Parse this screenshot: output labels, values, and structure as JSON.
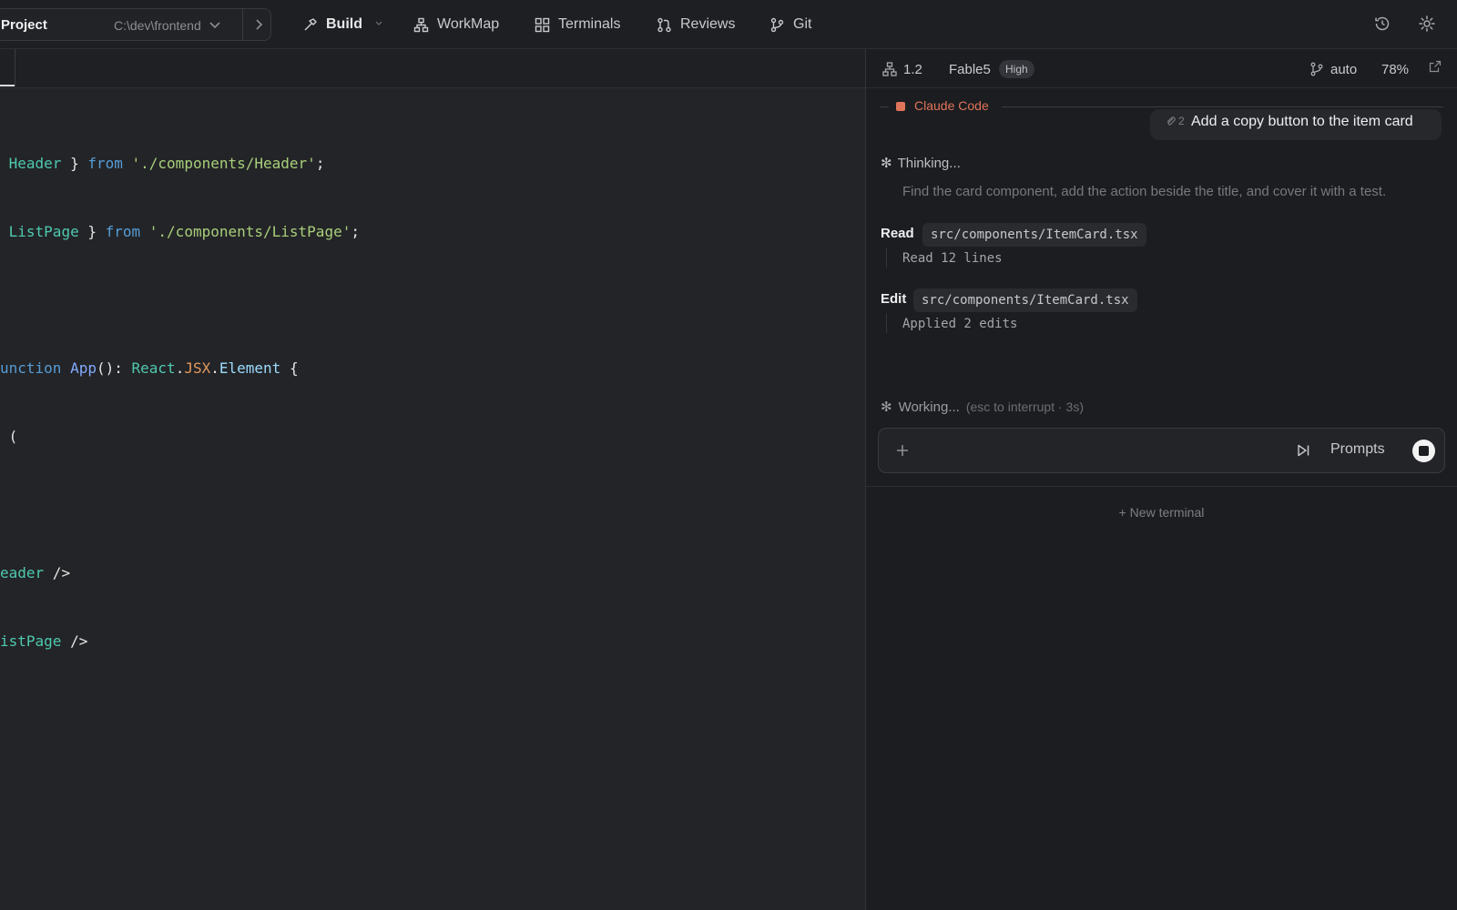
{
  "topbar": {
    "project_label": "Project",
    "project_path": "C:\\dev\\frontend",
    "nav": {
      "build": "Build",
      "workmap": "WorkMap",
      "terminals": "Terminals",
      "reviews": "Reviews",
      "git": "Git"
    },
    "icons": [
      "history-icon",
      "settings-gear-icon"
    ]
  },
  "editor": {
    "lines": [
      {
        "t1": "Header",
        "t2": " } ",
        "t3": "from",
        "t4": " ",
        "t5": "'./components/Header'",
        "t6": ";"
      },
      {
        "t1": "ListPage",
        "t2": " } ",
        "t3": "from",
        "t4": " ",
        "t5": "'./components/ListPage'",
        "t6": ";"
      },
      {},
      {
        "k1": "unction",
        "k2": " ",
        "k3": "App",
        "k4": "(): ",
        "k5": "React",
        "k6": ".",
        "k7": "JSX",
        "k8": ".",
        "k9": "Element",
        "k10": " {"
      },
      {
        "p1": "("
      },
      {},
      {
        "j1": "eader",
        "j2": " />"
      },
      {
        "j1": "istPage",
        "j2": " />"
      }
    ]
  },
  "panel": {
    "header": {
      "version": "1.2",
      "model": "Fable5",
      "effort_badge": "High",
      "mode": "auto",
      "percent": "78%"
    },
    "chat": {
      "section_label": "Claude Code",
      "user_message": {
        "attachments": "2",
        "text": "Add a copy button to the item card"
      },
      "thinking_label": "Thinking...",
      "thought_text": "Find the card component, add the action beside the title, and cover it with a test.",
      "tools": [
        {
          "name": "Read",
          "path": "src/components/ItemCard.tsx",
          "result": "Read 12 lines"
        },
        {
          "name": "Edit",
          "path": "src/components/ItemCard.tsx",
          "result": "Applied 2 edits"
        }
      ],
      "working_label": "Working...",
      "working_hint": "(esc to interrupt · 3s)"
    },
    "input": {
      "prompts_label": "Prompts"
    },
    "new_terminal_label": "+ New terminal"
  },
  "colors": {
    "accent": "#e0745a",
    "background": "#232427",
    "panel_background": "#1c1d20"
  }
}
